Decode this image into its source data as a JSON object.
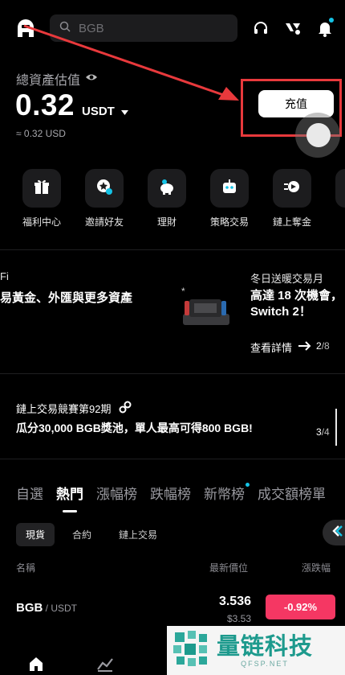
{
  "header": {
    "search_placeholder": "BGB",
    "icons": [
      "app-logo-icon",
      "search-icon",
      "headset-icon",
      "bitget-wallet-icon",
      "bell-icon"
    ]
  },
  "assets": {
    "label": "總資產估值",
    "value": "0.32",
    "unit": "USDT",
    "approx": "≈ 0.32 USD",
    "deposit_label": "充值"
  },
  "shortcuts": [
    {
      "label": "福利中心",
      "icon": "gift-icon"
    },
    {
      "label": "邀請好友",
      "icon": "invite-icon"
    },
    {
      "label": "理財",
      "icon": "piggy-bank-icon"
    },
    {
      "label": "策略交易",
      "icon": "robot-icon"
    },
    {
      "label": "鏈上奪金",
      "icon": "rocket-coin-icon"
    }
  ],
  "promo": {
    "left_line1": "Fi",
    "left_line2": "易黃金、外匯與更多資產",
    "right_line1": "冬日送暖交易月",
    "right_line2": "高達 18 次機會，",
    "right_line3": "Switch 2！",
    "link_label": "查看詳情",
    "page_current": "2",
    "page_total": "/8"
  },
  "competition": {
    "title": "鏈上交易競賽第92期",
    "body": "瓜分30,000 BGB獎池，單人最高可得800 BGB!",
    "page_current": "3",
    "page_total": "/4"
  },
  "market_tabs": [
    "自選",
    "熱門",
    "漲幅榜",
    "跌幅榜",
    "新幣榜",
    "成交額榜單"
  ],
  "active_market_tab": "熱門",
  "sub_tabs": [
    "現貨",
    "合約",
    "鏈上交易"
  ],
  "active_sub_tab": "現貨",
  "columns": {
    "name": "名稱",
    "price": "最新價位",
    "change": "漲跌幅"
  },
  "rows": [
    {
      "base": "BGB",
      "quote": " / USDT",
      "price": "3.536",
      "price_usd": "$3.53",
      "change": "-0.92%"
    }
  ],
  "watermark": {
    "main": "量链科技",
    "sub": "QFSP.NET"
  },
  "colors": {
    "accent_cyan": "#15c3e6",
    "negative": "#f53763",
    "annotation_red": "#e8393c",
    "watermark_green": "#1d9a8d"
  }
}
